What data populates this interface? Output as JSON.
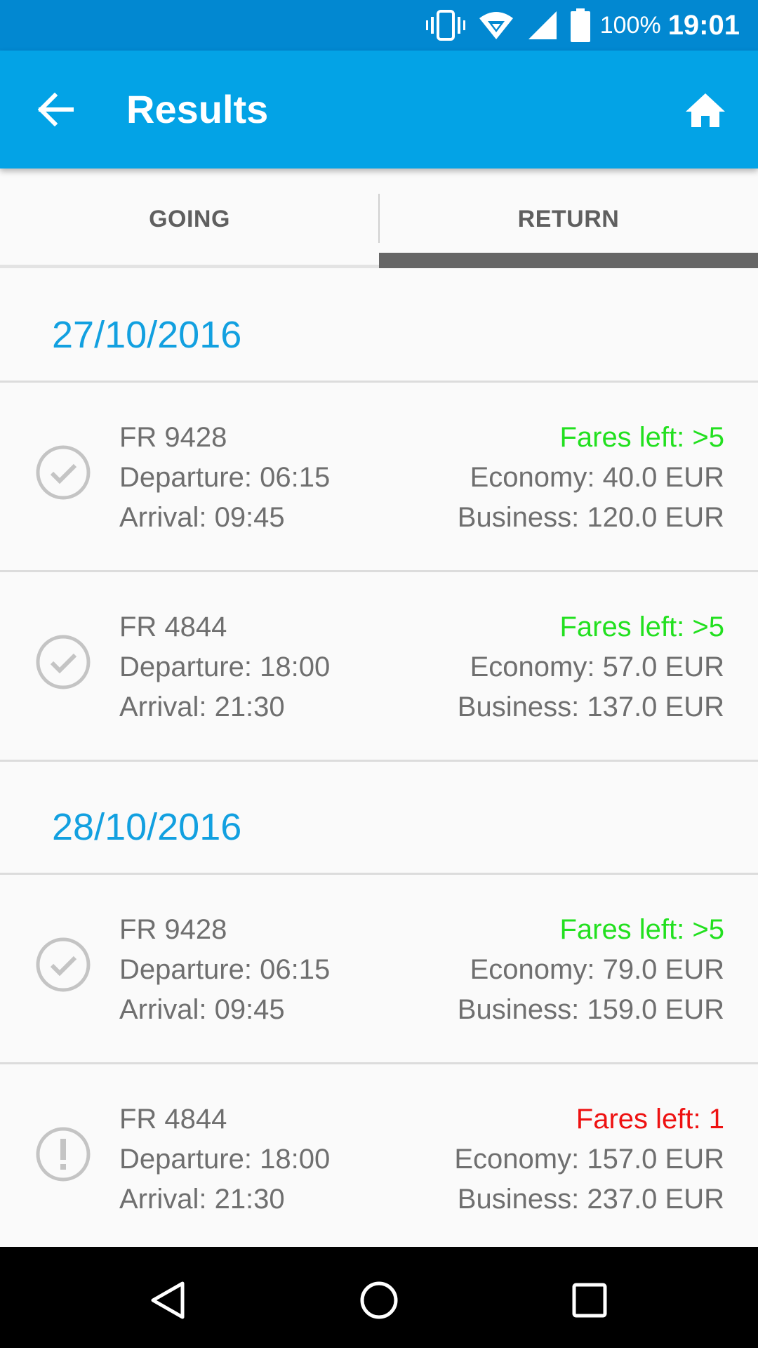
{
  "status_bar": {
    "battery_percent": "100%",
    "time": "19:01",
    "icons": [
      "vibrate-icon",
      "wifi-icon",
      "signal-icon",
      "battery-icon"
    ]
  },
  "app_bar": {
    "title": "Results",
    "back_icon": "arrow-back-icon",
    "home_icon": "home-icon"
  },
  "tabs": [
    {
      "label": "GOING",
      "selected": false
    },
    {
      "label": "RETURN",
      "selected": true
    }
  ],
  "colors": {
    "status_bar": "#0288d1",
    "app_bar": "#03a3e6",
    "date": "#12a0e0",
    "fares_ok": "#22e01f",
    "fares_low": "#ee1111",
    "tab_indicator": "#666666"
  },
  "days": [
    {
      "date": "27/10/2016",
      "flights": [
        {
          "code": "FR 9428",
          "departure": "Departure: 06:15",
          "arrival": "Arrival: 09:45",
          "fares": "Fares left: >5",
          "fares_status": "ok",
          "economy": "Economy: 40.0 EUR",
          "business": "Business: 120.0 EUR",
          "icon": "check-circle-icon"
        },
        {
          "code": "FR 4844",
          "departure": "Departure: 18:00",
          "arrival": "Arrival: 21:30",
          "fares": "Fares left: >5",
          "fares_status": "ok",
          "economy": "Economy: 57.0 EUR",
          "business": "Business: 137.0 EUR",
          "icon": "check-circle-icon"
        }
      ]
    },
    {
      "date": "28/10/2016",
      "flights": [
        {
          "code": "FR 9428",
          "departure": "Departure: 06:15",
          "arrival": "Arrival: 09:45",
          "fares": "Fares left: >5",
          "fares_status": "ok",
          "economy": "Economy: 79.0 EUR",
          "business": "Business: 159.0 EUR",
          "icon": "check-circle-icon"
        },
        {
          "code": "FR 4844",
          "departure": "Departure: 18:00",
          "arrival": "Arrival: 21:30",
          "fares": "Fares left: 1",
          "fares_status": "low",
          "economy": "Economy: 157.0 EUR",
          "business": "Business: 237.0 EUR",
          "icon": "alert-circle-icon"
        }
      ]
    }
  ],
  "nav_bar": {
    "icons": [
      "nav-back-icon",
      "nav-home-icon",
      "nav-recents-icon"
    ]
  }
}
